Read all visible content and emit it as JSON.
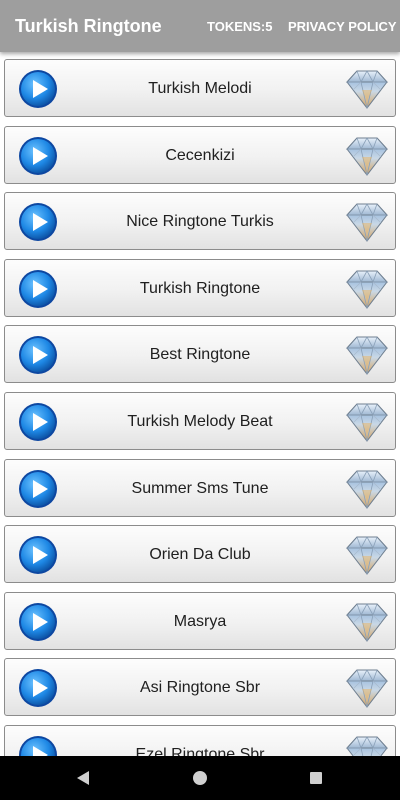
{
  "app": {
    "title": "Turkish Ringtone",
    "tokens_label": "TOKENS:5",
    "privacy_label": "PRIVACY POLICY"
  },
  "colors": {
    "appbar": "#9e9e9e",
    "play_blue": "#1e88e5",
    "row_border": "#8c8c8c"
  },
  "ringtones": [
    {
      "title": "Turkish Melodi"
    },
    {
      "title": "Cecenkizi"
    },
    {
      "title": "Nice Ringtone Turkis"
    },
    {
      "title": "Turkish Ringtone"
    },
    {
      "title": "Best Ringtone"
    },
    {
      "title": "Turkish Melody Beat"
    },
    {
      "title": "Summer Sms Tune"
    },
    {
      "title": "Orien Da Club"
    },
    {
      "title": "Masrya"
    },
    {
      "title": "Asi Ringtone Sbr"
    },
    {
      "title": "Ezel Ringtone Sbr"
    }
  ],
  "icons": {
    "play": "play-icon",
    "premium": "diamond-icon",
    "nav_back": "back-triangle-icon",
    "nav_home": "home-circle-icon",
    "nav_recents": "recents-square-icon"
  }
}
